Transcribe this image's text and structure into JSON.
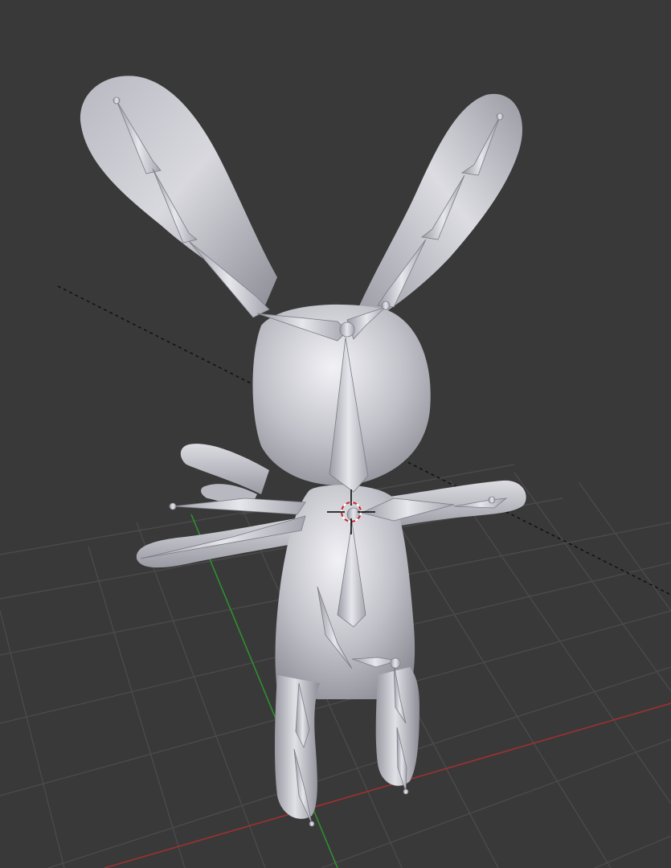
{
  "viewport": {
    "name": "3D Viewport",
    "background_color": "#393939",
    "grid_color": "#4a4a4a",
    "x_axis_color": "#a03030",
    "y_axis_color": "#2f8f2f",
    "object_type": "rigged rabbit mesh with armature",
    "mesh_color": "#c4c4cc",
    "bone_color": "#d2d2d8"
  },
  "cursor": {
    "icon": "3d-cursor-icon",
    "ring_colors": [
      "#c62828",
      "#ffffff"
    ]
  }
}
